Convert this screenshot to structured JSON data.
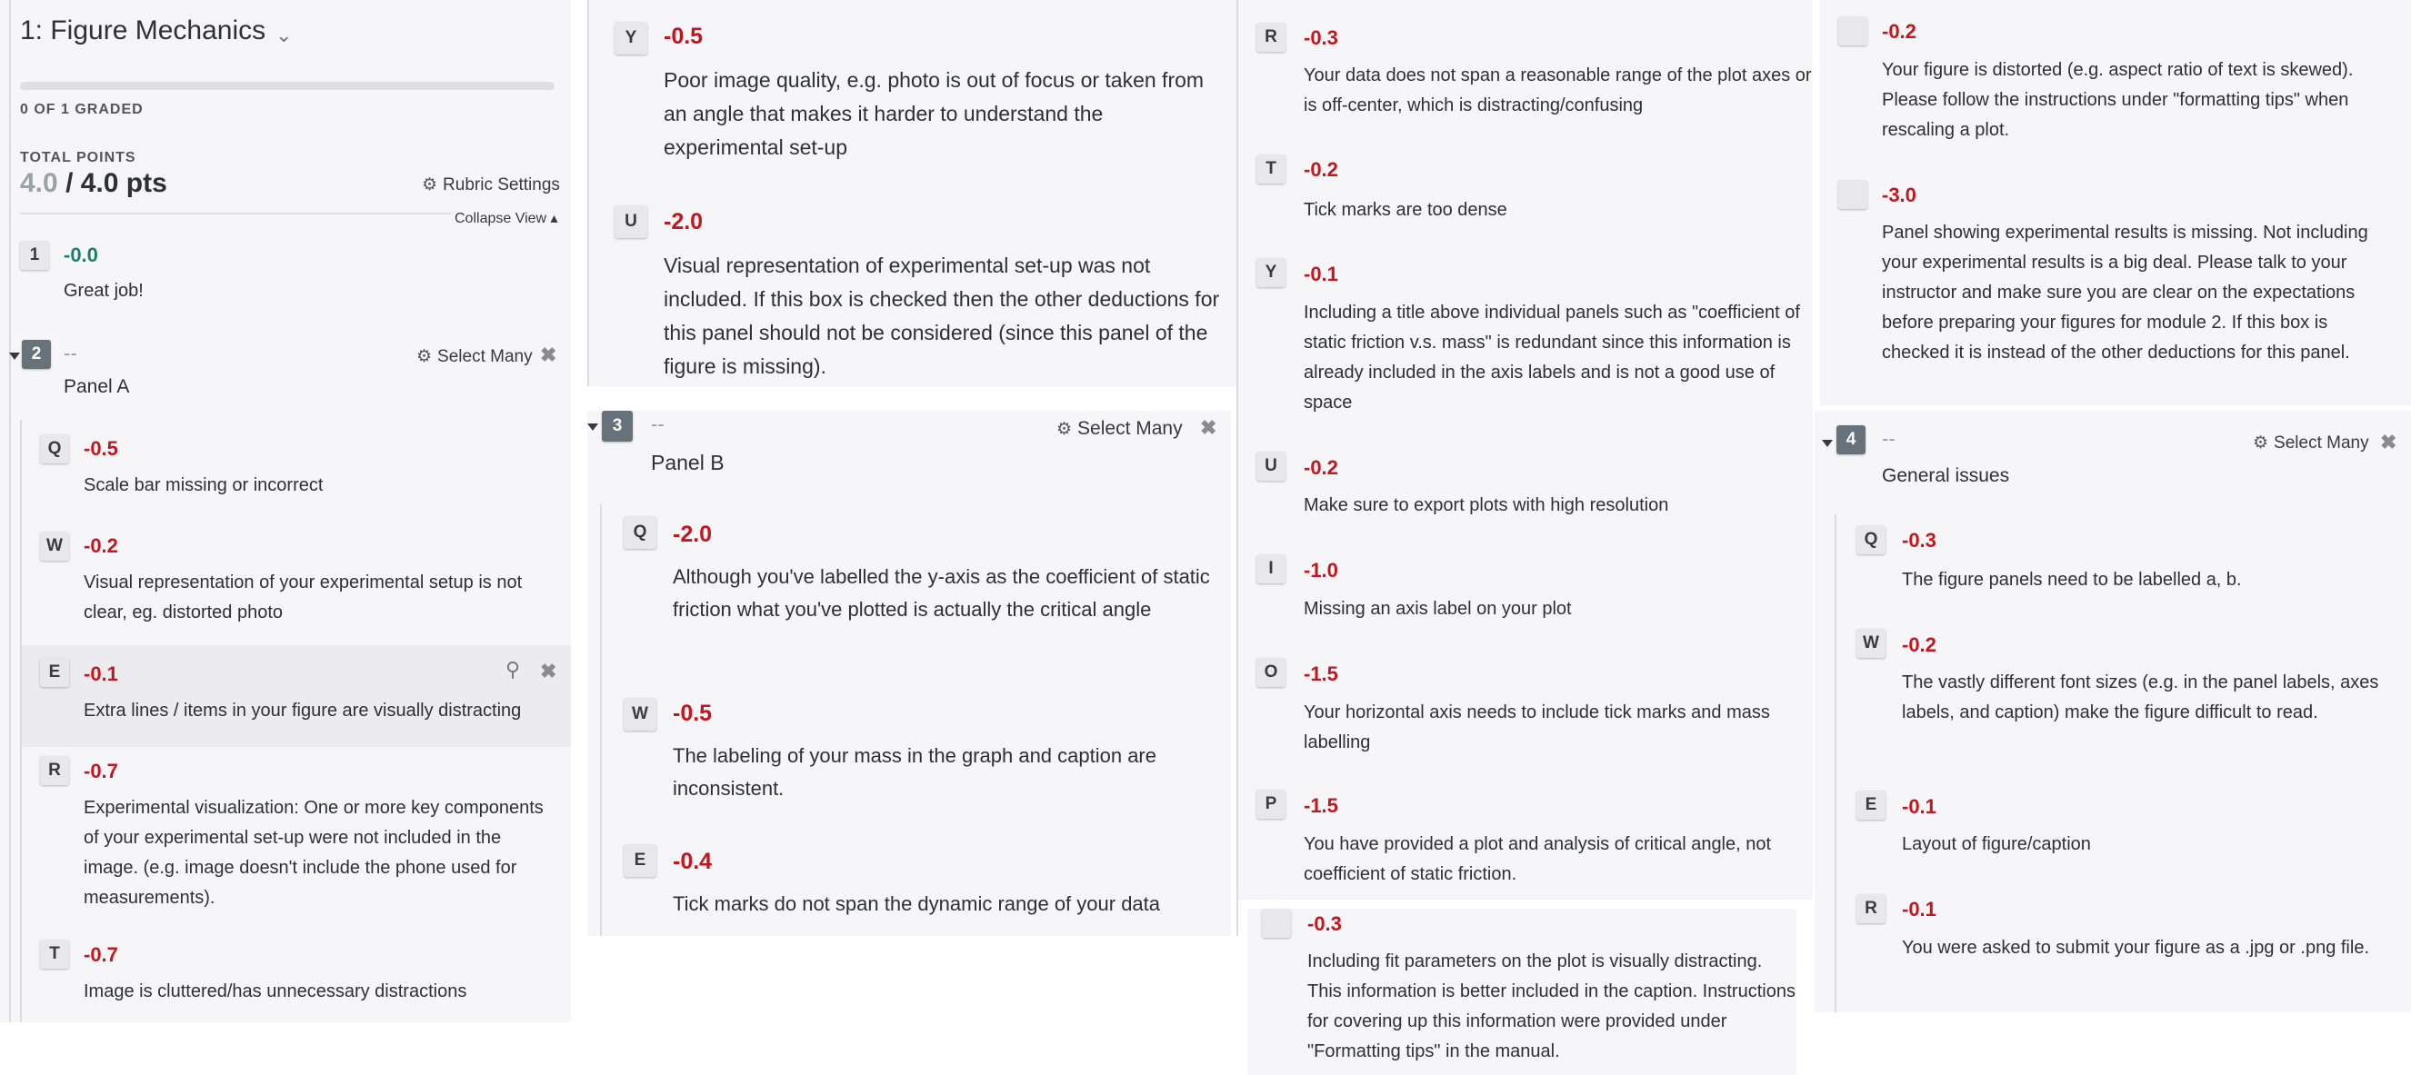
{
  "header": {
    "title": "1: Figure Mechanics",
    "graded_status": "0 OF 1 GRADED",
    "total_points_label": "TOTAL POINTS",
    "score": "4.0",
    "max": "/ 4.0 pts",
    "rubric_settings": "Rubric Settings",
    "collapse_view": "Collapse View"
  },
  "col1": {
    "item1": {
      "key": "1",
      "points": "-0.0",
      "text": "Great job!"
    },
    "group2": {
      "key": "2",
      "points": "--",
      "title": "Panel A",
      "select_many": "Select Many"
    },
    "items": [
      {
        "key": "Q",
        "points": "-0.5",
        "text": "Scale bar missing or incorrect"
      },
      {
        "key": "W",
        "points": "-0.2",
        "text": "Visual representation of your experimental setup is not clear, eg. distorted photo"
      },
      {
        "key": "E",
        "points": "-0.1",
        "text": "Extra lines / items in your figure are visually distracting"
      },
      {
        "key": "R",
        "points": "-0.7",
        "text": "Experimental visualization: One or more key components of your experimental set-up were not included in the image. (e.g. image doesn't include the phone used for measurements)."
      },
      {
        "key": "T",
        "points": "-0.7",
        "text": "Image is cluttered/has unnecessary distractions"
      }
    ]
  },
  "col2": {
    "top": [
      {
        "key": "Y",
        "points": "-0.5",
        "text": "Poor image quality, e.g. photo is out of focus or taken from an angle that makes it harder to understand the experimental set-up"
      },
      {
        "key": "U",
        "points": "-2.0",
        "text": "Visual representation of experimental set-up was not included. If this box is checked then the other deductions for this panel should not be considered (since this panel of the figure is missing)."
      }
    ],
    "group3": {
      "key": "3",
      "points": "--",
      "title": "Panel B",
      "select_many": "Select Many"
    },
    "items": [
      {
        "key": "Q",
        "points": "-2.0",
        "text": "Although you've labelled the y-axis as the coefficient of static friction what you've plotted is actually the critical angle"
      },
      {
        "key": "W",
        "points": "-0.5",
        "text": "The labeling of your mass in the graph and caption are inconsistent."
      },
      {
        "key": "E",
        "points": "-0.4",
        "text": "Tick marks do not span the dynamic range of your data"
      }
    ]
  },
  "col3": {
    "items": [
      {
        "key": "R",
        "points": "-0.3",
        "text": "Your data does not span a reasonable range of the plot axes or is off-center, which is distracting/confusing"
      },
      {
        "key": "T",
        "points": "-0.2",
        "text": "Tick marks are too dense"
      },
      {
        "key": "Y",
        "points": "-0.1",
        "text": "Including a title above individual panels such as \"coefficient of static friction v.s. mass\" is redundant since this information is already included in the axis labels and is not a good use of space"
      },
      {
        "key": "U",
        "points": "-0.2",
        "text": "Make sure to export plots with high resolution"
      },
      {
        "key": "I",
        "points": "-1.0",
        "text": "Missing an axis label on your plot"
      },
      {
        "key": "O",
        "points": "-1.5",
        "text": "Your horizontal axis needs to include tick marks and mass labelling"
      },
      {
        "key": "P",
        "points": "-1.5",
        "text": "You have provided a plot and analysis of critical angle, not coefficient of static friction."
      },
      {
        "key": "",
        "points": "-0.3",
        "text": "Including fit parameters on the plot is visually distracting. This information is better included in the caption. Instructions for covering up this information were provided under \"Formatting tips\" in the manual."
      }
    ]
  },
  "col4": {
    "top": [
      {
        "key": "",
        "points": "-0.2",
        "text": "Your figure is distorted (e.g. aspect ratio of text is skewed). Please follow the instructions under \"formatting tips\" when rescaling a plot."
      },
      {
        "key": "",
        "points": "-3.0",
        "text": "Panel showing experimental results is missing. Not including your experimental results is a big deal. Please talk to your instructor and make sure you are clear on the expectations before preparing your figures for module 2. If this box is checked it is instead of the other deductions for this panel."
      }
    ],
    "group4": {
      "key": "4",
      "points": "--",
      "title": "General issues",
      "select_many": "Select Many"
    },
    "items": [
      {
        "key": "Q",
        "points": "-0.3",
        "text": "The figure panels need to be labelled a, b."
      },
      {
        "key": "W",
        "points": "-0.2",
        "text": "The vastly different font sizes (e.g. in the panel labels, axes labels, and caption) make the figure difficult to read."
      },
      {
        "key": "E",
        "points": "-0.1",
        "text": "Layout of figure/caption"
      },
      {
        "key": "R",
        "points": "-0.1",
        "text": "You were asked to submit your figure as a .jpg or .png file."
      }
    ]
  }
}
